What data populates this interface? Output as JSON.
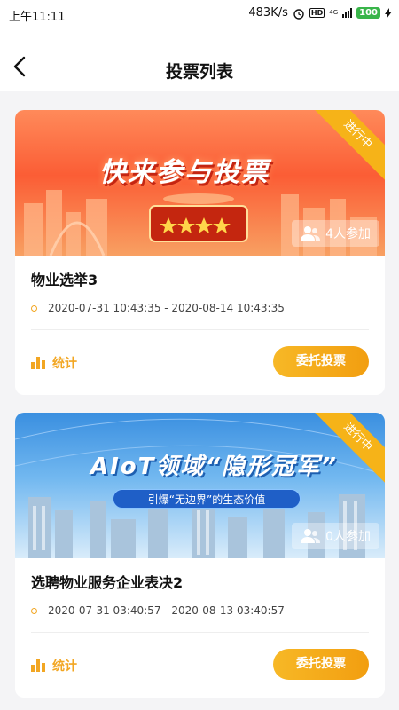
{
  "status_bar": {
    "time": "上午11:11",
    "network_speed": "483K/s",
    "network_type": "4G",
    "battery": "100"
  },
  "header": {
    "title": "投票列表",
    "back_icon": "chevron-left-icon"
  },
  "votes": [
    {
      "banner_text": "快来参与投票",
      "status": "进行中",
      "participants": "4人参加",
      "name": "物业选举3",
      "time_range": "2020-07-31 10:43:35 - 2020-08-14 10:43:35",
      "stats_label": "统计",
      "action_label": "委托投票"
    },
    {
      "banner_text": "AIoT领域“隐形冠军”",
      "banner_subtext": "引爆“无边界”的生态价值",
      "status": "进行中",
      "participants": "0人参加",
      "name": "选聘物业服务企业表决2",
      "time_range": "2020-07-31 03:40:57 - 2020-08-13 03:40:57",
      "stats_label": "统计",
      "action_label": "委托投票"
    }
  ],
  "colors": {
    "accent": "#f2a622",
    "badge": "#f6b318",
    "battery": "#39b54a"
  }
}
